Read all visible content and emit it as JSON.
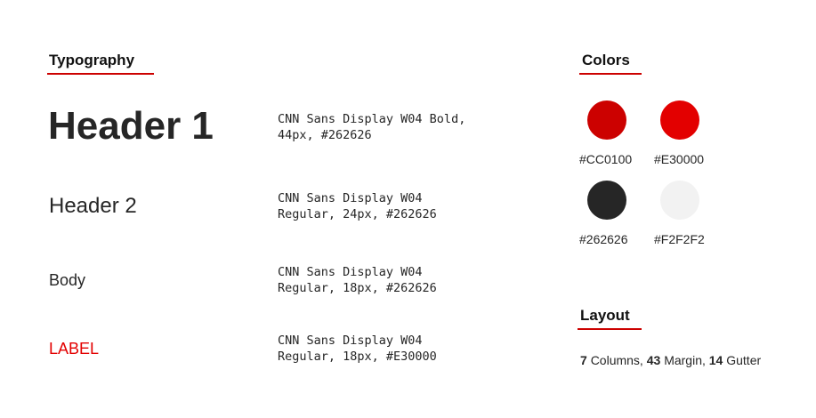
{
  "typography": {
    "heading": "Typography",
    "samples": [
      {
        "label": "Header 1",
        "desc_line1": "CNN Sans Display W04 Bold,",
        "desc_line2": "44px, #262626"
      },
      {
        "label": "Header 2",
        "desc_line1": "CNN Sans Display W04",
        "desc_line2": "Regular, 24px, #262626"
      },
      {
        "label": "Body",
        "desc_line1": "CNN Sans Display W04",
        "desc_line2": "Regular, 18px, #262626"
      },
      {
        "label": "LABEL",
        "desc_line1": "CNN Sans Display W04",
        "desc_line2": "Regular, 18px, #E30000"
      }
    ]
  },
  "colors": {
    "heading": "Colors",
    "swatches": [
      {
        "hex": "#CC0100",
        "label": "#CC0100"
      },
      {
        "hex": "#E30000",
        "label": "#E30000"
      },
      {
        "hex": "#262626",
        "label": "#262626"
      },
      {
        "hex": "#F2F2F2",
        "label": "#F2F2F2"
      }
    ]
  },
  "layout": {
    "heading": "Layout",
    "columns_value": "7",
    "columns_label": "Columns,",
    "margin_value": "43",
    "margin_label": "Margin,",
    "gutter_value": "14",
    "gutter_label": "Gutter"
  },
  "accent_color": "#CC0100"
}
